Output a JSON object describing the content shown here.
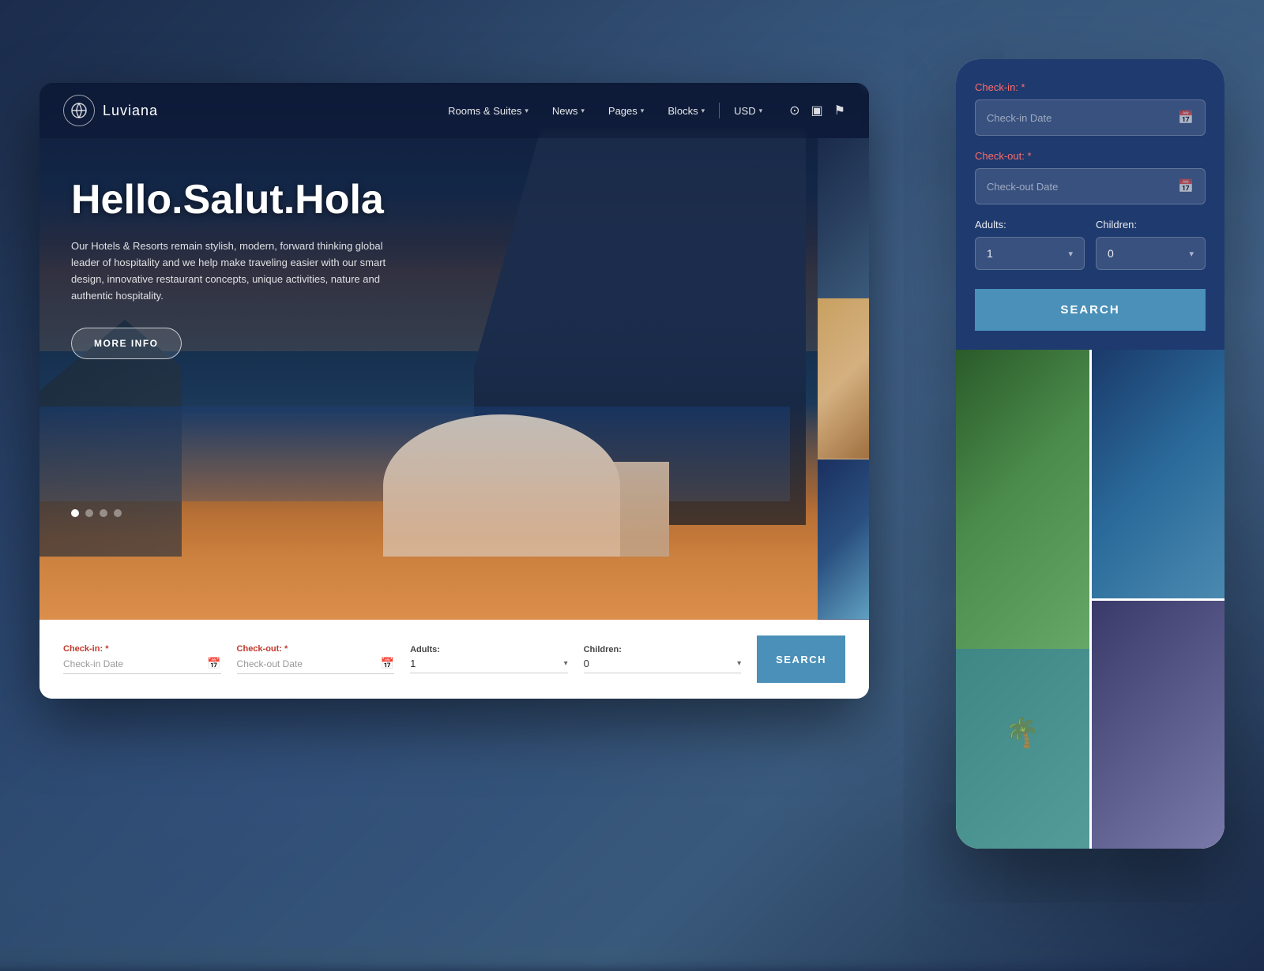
{
  "app": {
    "name": "Luviana"
  },
  "navbar": {
    "logo_text": "Luviana",
    "links": [
      {
        "label": "Rooms & Suites",
        "hasDropdown": true
      },
      {
        "label": "News",
        "hasDropdown": true
      },
      {
        "label": "Pages",
        "hasDropdown": true
      },
      {
        "label": "Blocks",
        "hasDropdown": true
      },
      {
        "label": "USD",
        "hasDropdown": true
      }
    ]
  },
  "hero": {
    "title": "Hello.Salut.Hola",
    "subtitle": "Our Hotels & Resorts remain stylish, modern, forward thinking global leader of hospitality and we help make traveling easier with our smart design, innovative restaurant concepts, unique activities, nature and authentic hospitality.",
    "cta_label": "MORE INFO"
  },
  "booking_bar": {
    "checkin_label": "Check-in:",
    "checkin_required": "*",
    "checkin_placeholder": "Check-in Date",
    "checkout_label": "Check-out:",
    "checkout_required": "*",
    "checkout_placeholder": "Check-out Date",
    "adults_label": "Adults:",
    "adults_value": "1",
    "children_label": "Children:",
    "children_value": "0",
    "search_label": "SEARCH"
  },
  "mobile_booking": {
    "checkin_label": "Check-in:",
    "checkin_required": "*",
    "checkin_placeholder": "Check-in Date",
    "checkout_label": "Check-out:",
    "checkout_required": "*",
    "checkout_placeholder": "Check-out Date",
    "adults_label": "Adults:",
    "adults_value": "1",
    "children_label": "Children:",
    "children_value": "0",
    "search_label": "SEARCH"
  },
  "colors": {
    "navy": "#1e3a6e",
    "teal": "#4a90b8",
    "white": "#ffffff"
  }
}
